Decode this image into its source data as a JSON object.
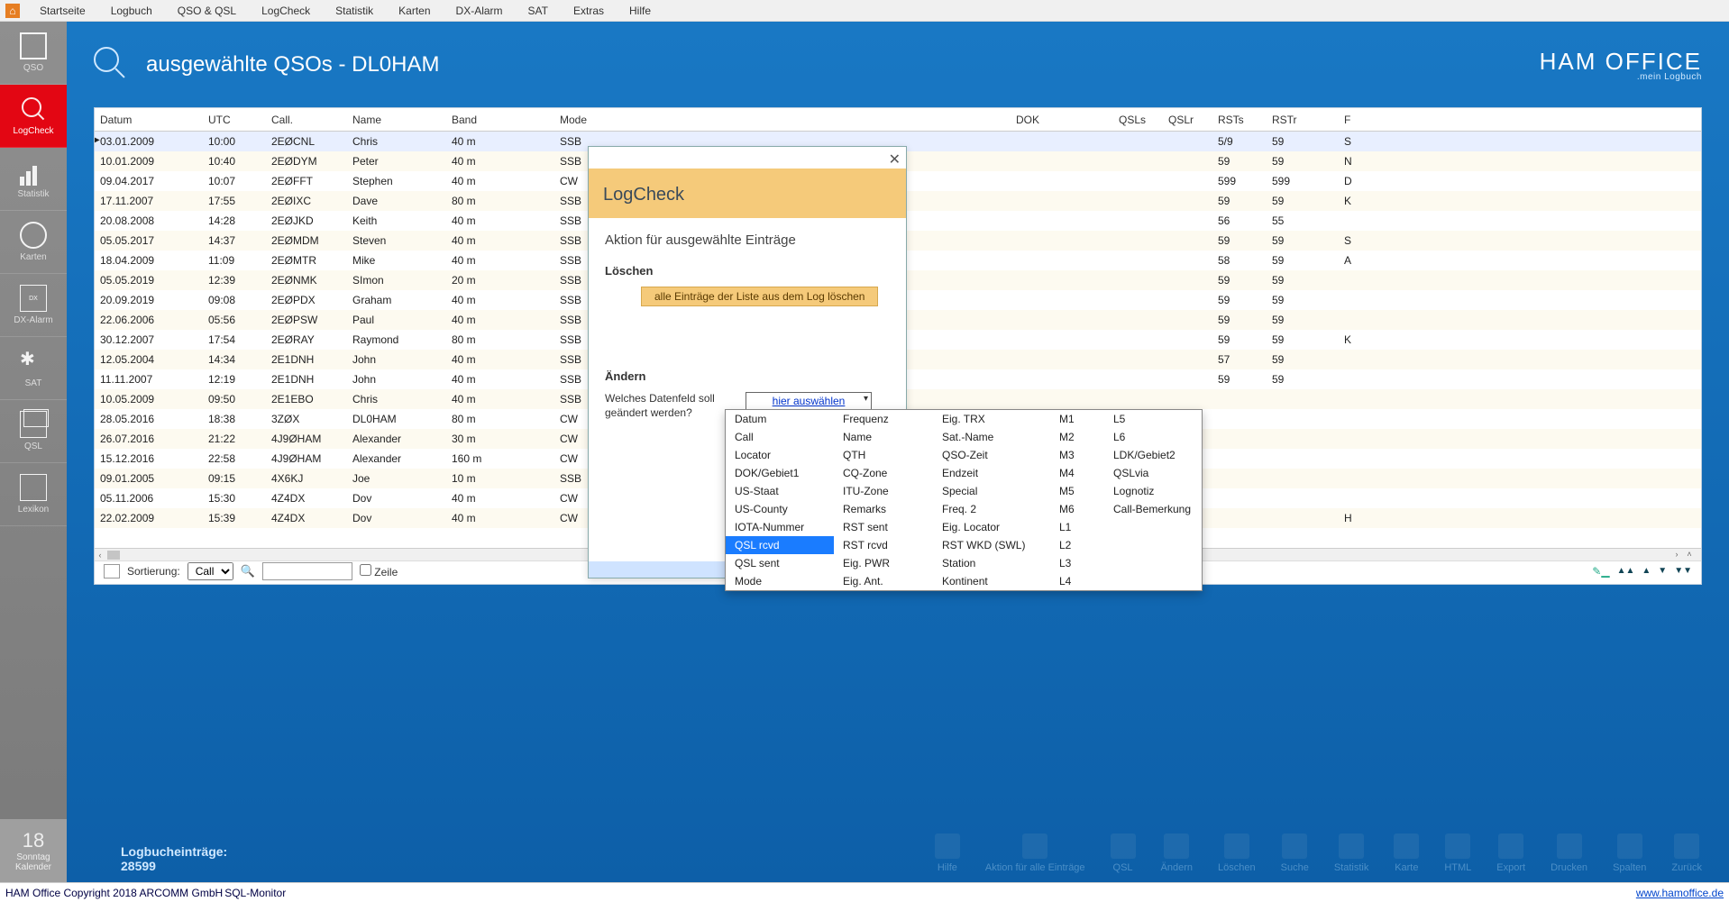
{
  "menu": [
    "Startseite",
    "Logbuch",
    "QSO & QSL",
    "LogCheck",
    "Statistik",
    "Karten",
    "DX-Alarm",
    "SAT",
    "Extras",
    "Hilfe"
  ],
  "leftbar": [
    {
      "id": "qso",
      "label": "QSO"
    },
    {
      "id": "logcheck",
      "label": "LogCheck",
      "active": true
    },
    {
      "id": "statistik",
      "label": "Statistik"
    },
    {
      "id": "karten",
      "label": "Karten"
    },
    {
      "id": "dxalarm",
      "label": "DX-Alarm"
    },
    {
      "id": "sat",
      "label": "SAT"
    },
    {
      "id": "qsl",
      "label": "QSL"
    },
    {
      "id": "lexikon",
      "label": "Lexikon"
    }
  ],
  "calendar": {
    "daynum": "18",
    "weekday": "Sonntag",
    "label": "Kalender"
  },
  "page": {
    "title": "ausgewählte QSOs  -  DL0HAM"
  },
  "brand": {
    "name": "HAM OFFICE",
    "tagline": ".mein Logbuch"
  },
  "columns": [
    "Datum",
    "UTC",
    "Call.",
    "Name",
    "Band",
    "Mode",
    "DOK",
    "QSLs",
    "QSLr",
    "RSTs",
    "RSTr",
    "F"
  ],
  "rows": [
    {
      "sel": true,
      "mark": "▶",
      "d": "03.01.2009",
      "u": "10:00",
      "c": "2EØCNL",
      "n": "Chris",
      "b": "40 m",
      "m": "SSB",
      "dok": "",
      "qs": "",
      "qr": "",
      "rs": "5/9",
      "rr": "59",
      "f": "S"
    },
    {
      "d": "10.01.2009",
      "u": "10:40",
      "c": "2EØDYM",
      "n": "Peter",
      "b": "40 m",
      "m": "SSB",
      "dok": "",
      "qs": "",
      "qr": "",
      "rs": "59",
      "rr": "59",
      "f": "N"
    },
    {
      "d": "09.04.2017",
      "u": "10:07",
      "c": "2EØFFT",
      "n": "Stephen",
      "b": "40 m",
      "m": "CW",
      "dok": "",
      "qs": "",
      "qr": "",
      "rs": "599",
      "rr": "599",
      "f": "D"
    },
    {
      "d": "17.11.2007",
      "u": "17:55",
      "c": "2EØIXC",
      "n": "Dave",
      "b": "80 m",
      "m": "SSB",
      "dok": "",
      "qs": "",
      "qr": "",
      "rs": "59",
      "rr": "59",
      "f": "K"
    },
    {
      "d": "20.08.2008",
      "u": "14:28",
      "c": "2EØJKD",
      "n": "Keith",
      "b": "40 m",
      "m": "SSB",
      "dok": "",
      "qs": "",
      "qr": "",
      "rs": "56",
      "rr": "55",
      "f": ""
    },
    {
      "d": "05.05.2017",
      "u": "14:37",
      "c": "2EØMDM",
      "n": "Steven",
      "b": "40 m",
      "m": "SSB",
      "dok": "",
      "qs": "",
      "qr": "",
      "rs": "59",
      "rr": "59",
      "f": "S"
    },
    {
      "d": "18.04.2009",
      "u": "11:09",
      "c": "2EØMTR",
      "n": "Mike",
      "b": "40 m",
      "m": "SSB",
      "dok": "",
      "qs": "",
      "qr": "",
      "rs": "58",
      "rr": "59",
      "f": "A"
    },
    {
      "d": "05.05.2019",
      "u": "12:39",
      "c": "2EØNMK",
      "n": "SImon",
      "b": "20 m",
      "m": "SSB",
      "dok": "",
      "qs": "",
      "qr": "",
      "rs": "59",
      "rr": "59",
      "f": ""
    },
    {
      "d": "20.09.2019",
      "u": "09:08",
      "c": "2EØPDX",
      "n": "Graham",
      "b": "40 m",
      "m": "SSB",
      "dok": "",
      "qs": "",
      "qr": "",
      "rs": "59",
      "rr": "59",
      "f": ""
    },
    {
      "d": "22.06.2006",
      "u": "05:56",
      "c": "2EØPSW",
      "n": "Paul",
      "b": "40 m",
      "m": "SSB",
      "dok": "",
      "qs": "",
      "qr": "",
      "rs": "59",
      "rr": "59",
      "f": ""
    },
    {
      "d": "30.12.2007",
      "u": "17:54",
      "c": "2EØRAY",
      "n": "Raymond",
      "b": "80 m",
      "m": "SSB",
      "dok": "",
      "qs": "",
      "qr": "",
      "rs": "59",
      "rr": "59",
      "f": "K"
    },
    {
      "d": "12.05.2004",
      "u": "14:34",
      "c": "2E1DNH",
      "n": "John",
      "b": "40 m",
      "m": "SSB",
      "dok": "",
      "qs": "",
      "qr": "",
      "rs": "57",
      "rr": "59",
      "f": ""
    },
    {
      "d": "11.11.2007",
      "u": "12:19",
      "c": "2E1DNH",
      "n": "John",
      "b": "40 m",
      "m": "SSB",
      "dok": "",
      "qs": "",
      "qr": "",
      "rs": "59",
      "rr": "59",
      "f": ""
    },
    {
      "d": "10.05.2009",
      "u": "09:50",
      "c": "2E1EBO",
      "n": "Chris",
      "b": "40 m",
      "m": "SSB",
      "dok": "",
      "qs": "",
      "qr": "",
      "rs": "",
      "rr": "",
      "f": ""
    },
    {
      "d": "28.05.2016",
      "u": "18:38",
      "c": "3ZØX",
      "n": "DL0HAM",
      "b": "80 m",
      "m": "CW",
      "dok": "",
      "qs": "",
      "qr": "",
      "rs": "",
      "rr": "",
      "f": ""
    },
    {
      "d": "26.07.2016",
      "u": "21:22",
      "c": "4J9ØHAM",
      "n": "Alexander",
      "b": "30 m",
      "m": "CW",
      "dok": "",
      "qs": "",
      "qr": "",
      "rs": "",
      "rr": "",
      "f": ""
    },
    {
      "d": "15.12.2016",
      "u": "22:58",
      "c": "4J9ØHAM",
      "n": "Alexander",
      "b": "160 m",
      "m": "CW",
      "dok": "",
      "qs": "",
      "qr": "",
      "rs": "",
      "rr": "",
      "f": ""
    },
    {
      "d": "09.01.2005",
      "u": "09:15",
      "c": "4X6KJ",
      "n": "Joe",
      "b": "10 m",
      "m": "SSB",
      "dok": "",
      "qs": "",
      "qr": "",
      "rs": "",
      "rr": "",
      "f": ""
    },
    {
      "d": "05.11.2006",
      "u": "15:30",
      "c": "4Z4DX",
      "n": "Dov",
      "b": "40 m",
      "m": "CW",
      "dok": "",
      "qs": "",
      "qr": "",
      "rs": "",
      "rr": "",
      "f": ""
    },
    {
      "d": "22.02.2009",
      "u": "15:39",
      "c": "4Z4DX",
      "n": "Dov",
      "b": "40 m",
      "m": "CW",
      "dok": "",
      "qs": "",
      "qr": "",
      "rs": "",
      "rr": "",
      "f": "H"
    }
  ],
  "sortbar": {
    "label": "Sortierung:",
    "value": "Call",
    "zeile": "Zeile"
  },
  "footer": {
    "entries_label": "Logbucheinträge:",
    "entries_count": "28599",
    "actions": [
      "Hilfe",
      "Aktion für alle Einträge",
      "QSL",
      "Ändern",
      "Löschen",
      "Suche",
      "Statistik",
      "Karte",
      "HTML",
      "Export",
      "Drucken",
      "Spalten",
      "Zurück"
    ]
  },
  "status": {
    "left": "HAM Office Copyright 2018 ARCOMM GmbH",
    "mid": "SQL-Monitor",
    "right": "www.hamoffice.de"
  },
  "modal": {
    "title": "LogCheck",
    "subtitle": "Aktion für ausgewählte Einträge",
    "delete_heading": "Löschen",
    "delete_btn": "alle Einträge der Liste aus dem Log löschen",
    "change_heading": "Ändern",
    "field_question": "Welches Datenfeld soll geändert werden?",
    "select_placeholder": "hier auswählen"
  },
  "dropdown": {
    "selected": "QSL rcvd",
    "cols": [
      [
        "Datum",
        "Call",
        "Locator",
        "DOK/Gebiet1",
        "US-Staat",
        "US-County",
        "IOTA-Nummer",
        "QSL rcvd",
        "QSL sent",
        "Mode"
      ],
      [
        "Frequenz",
        "Name",
        "QTH",
        "CQ-Zone",
        "ITU-Zone",
        "Remarks",
        "RST sent",
        "RST rcvd",
        "Eig. PWR",
        "Eig. Ant."
      ],
      [
        "Eig. TRX",
        "Sat.-Name",
        "QSO-Zeit",
        "Endzeit",
        "Special",
        "Freq. 2",
        "Eig. Locator",
        "RST WKD (SWL)",
        "Station",
        "Kontinent"
      ],
      [
        "M1",
        "M2",
        "M3",
        "M4",
        "M5",
        "M6",
        "L1",
        "L2",
        "L3",
        "L4"
      ],
      [
        "L5",
        "L6",
        "LDK/Gebiet2",
        "QSLvia",
        "Lognotiz",
        "Call-Bemerkung",
        "",
        "",
        "",
        ""
      ]
    ]
  }
}
